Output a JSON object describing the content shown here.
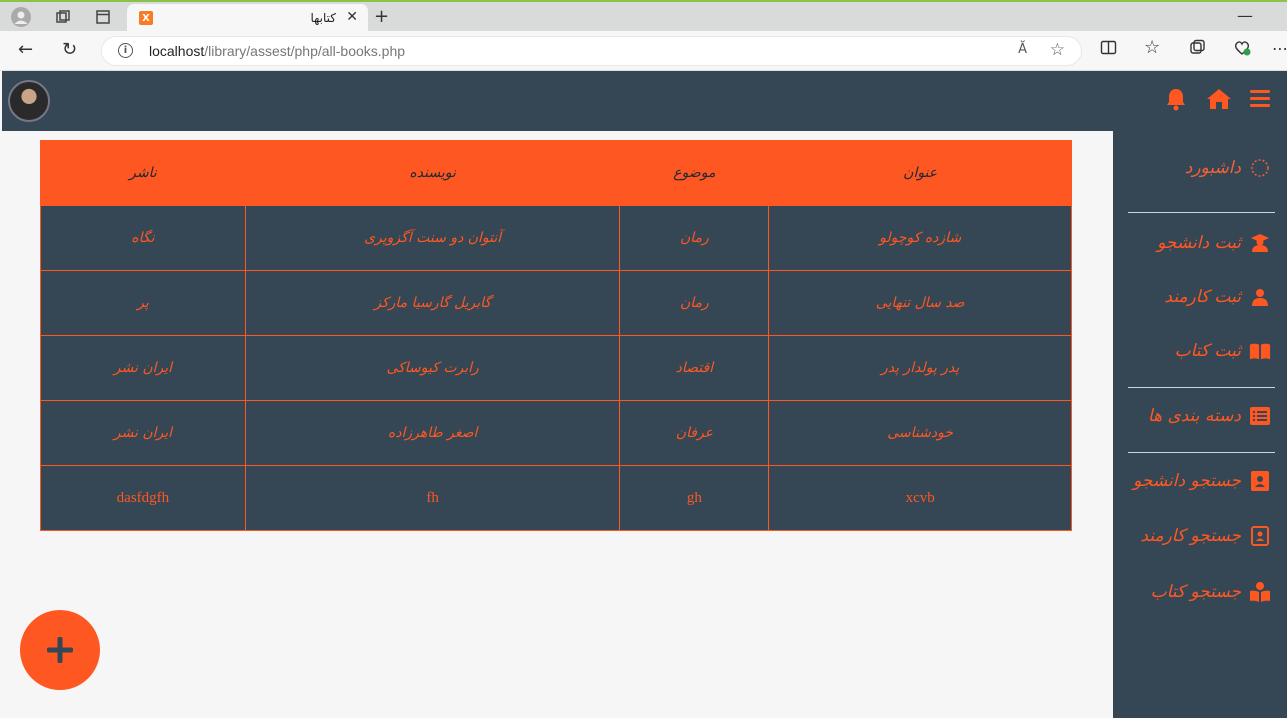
{
  "browser": {
    "tab_title": "کتابها",
    "url_host": "localhost",
    "url_path": "/library/assest/php/all-books.php",
    "reader_label": "Ă",
    "colors": {
      "accent_border": "#8bc34a"
    }
  },
  "header": {
    "icons": [
      "menu-icon",
      "home-icon",
      "bell-icon"
    ],
    "colors": {
      "background": "#354654",
      "accent": "#ff5722"
    }
  },
  "sidebar": {
    "dashboard_label": "داشبورد",
    "items": [
      {
        "label": "ثبت دانشجو",
        "icon": "student-icon"
      },
      {
        "label": "ثبت کارمند",
        "icon": "employees-icon"
      },
      {
        "label": "ثبت کتاب",
        "icon": "open-book-icon"
      },
      {
        "label": "دسته بندی ها",
        "icon": "list-icon"
      },
      {
        "label": "جستجو دانشجو",
        "icon": "contact-card-icon"
      },
      {
        "label": "جستجو کارمند",
        "icon": "address-book-icon"
      },
      {
        "label": "جستجو کتاب",
        "icon": "book-reader-icon"
      }
    ]
  },
  "table": {
    "headers": [
      "عنوان",
      "موضوع",
      "نویسنده",
      "ناشر"
    ],
    "rows": [
      [
        "شازده کوچولو",
        "رمان",
        "آنتوان دو سنت آگزوپری",
        "نگاه"
      ],
      [
        "صد سال تنهایی",
        "رمان",
        "گابریل گارسیا مارکز",
        "پر"
      ],
      [
        "پدر پولدار پدر",
        "اقتصاد",
        "رابرت کیوساکی",
        "ایران نشر"
      ],
      [
        "خودشناسی",
        "عرفان",
        "اصغر طاهرزاده",
        "ایران نشر"
      ],
      [
        "xcvb",
        "gh",
        "fh",
        "dasfdgfh"
      ]
    ]
  },
  "fab": {
    "label": "+"
  }
}
